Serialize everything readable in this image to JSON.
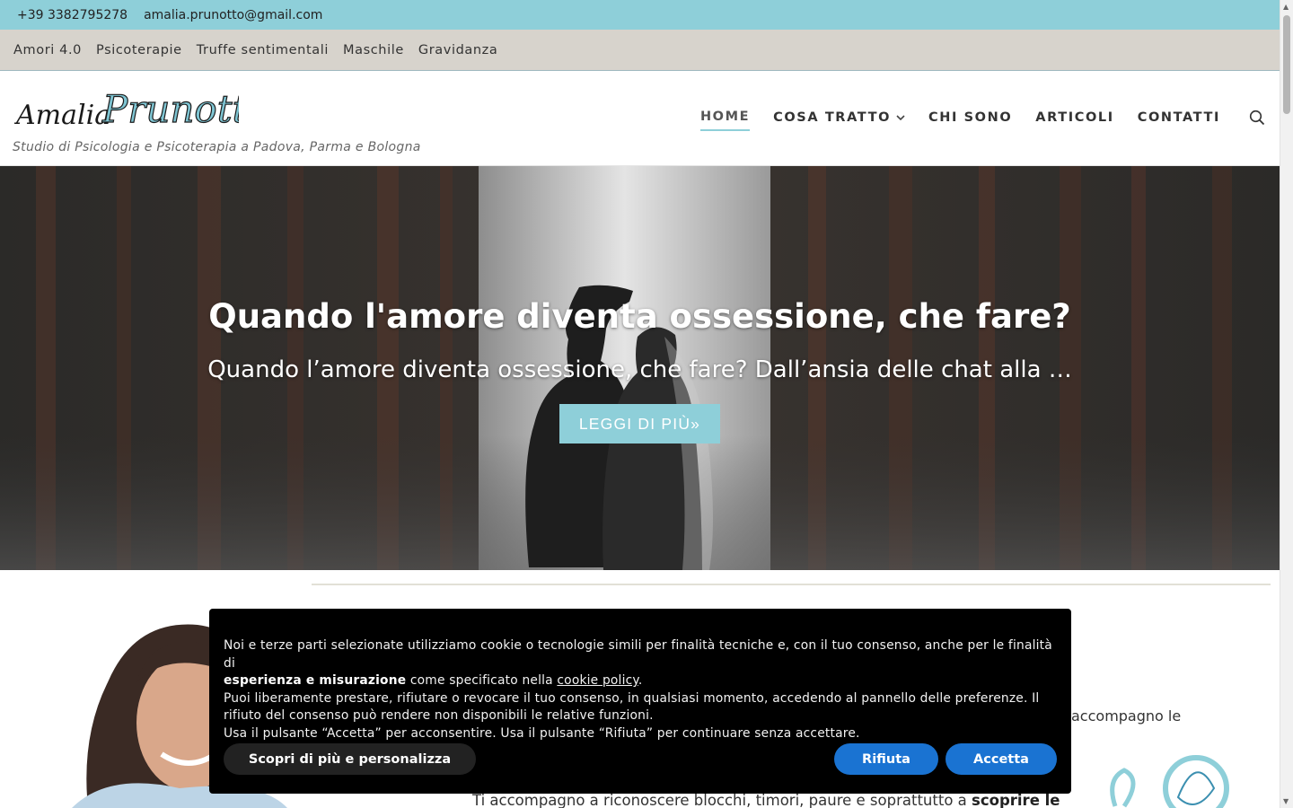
{
  "topbar": {
    "phone": "+39 3382795278",
    "email": "amalia.prunotto@gmail.com"
  },
  "secondary_menu": {
    "items": [
      "Amori 4.0",
      "Psicoterapie",
      "Truffe sentimentali",
      "Maschile",
      "Gravidanza"
    ]
  },
  "header": {
    "logo_text_first": "Amalia",
    "logo_text_last": "Prunotto",
    "tagline": "Studio di Psicologia e Psicoterapia a Padova, Parma e Bologna"
  },
  "main_nav": {
    "home": "HOME",
    "cosa_tratto": "COSA TRATTO",
    "chi_sono": "CHI SONO",
    "articoli": "ARTICOLI",
    "contatti": "CONTATTI"
  },
  "hero": {
    "title": "Quando l'amore diventa ossessione, che fare?",
    "subtitle": "Quando l’amore diventa ossessione, che fare? Dall’ansia delle chat alla …",
    "button": "LEGGI DI PIÙ»"
  },
  "content": {
    "text_right": "accompagno le",
    "text_bottom_plain": "Ti accompagno a riconoscere blocchi, timori, paure e soprattutto a ",
    "text_bottom_bold": "scoprire le"
  },
  "cookie_banner": {
    "line1_a": "Noi e terze parti selezionate utilizziamo cookie o tecnologie simili per finalità tecniche e, con il tuo consenso, anche per le finalità di",
    "line2_bold": "esperienza e misurazione",
    "line2_mid": " come specificato nella ",
    "line2_link": "cookie policy",
    "line2_end": ".",
    "line3": "Puoi liberamente prestare, rifiutare o revocare il tuo consenso, in qualsiasi momento, accedendo al pannello delle preferenze. Il rifiuto del consenso può rendere non disponibili le relative funzioni.",
    "line4": "Usa il pulsante “Accetta” per acconsentire. Usa il pulsante “Rifiuta” per continuare senza accettare.",
    "btn_more": "Scopri di più e personalizza",
    "btn_reject": "Rifiuta",
    "btn_accept": "Accetta"
  },
  "colors": {
    "accent": "#8ecfd9",
    "secondary_bar": "#d7d3cc",
    "cookie_button": "#1a73d2"
  },
  "icons": {
    "search": "search-icon",
    "chevron": "chevron-down-icon"
  }
}
